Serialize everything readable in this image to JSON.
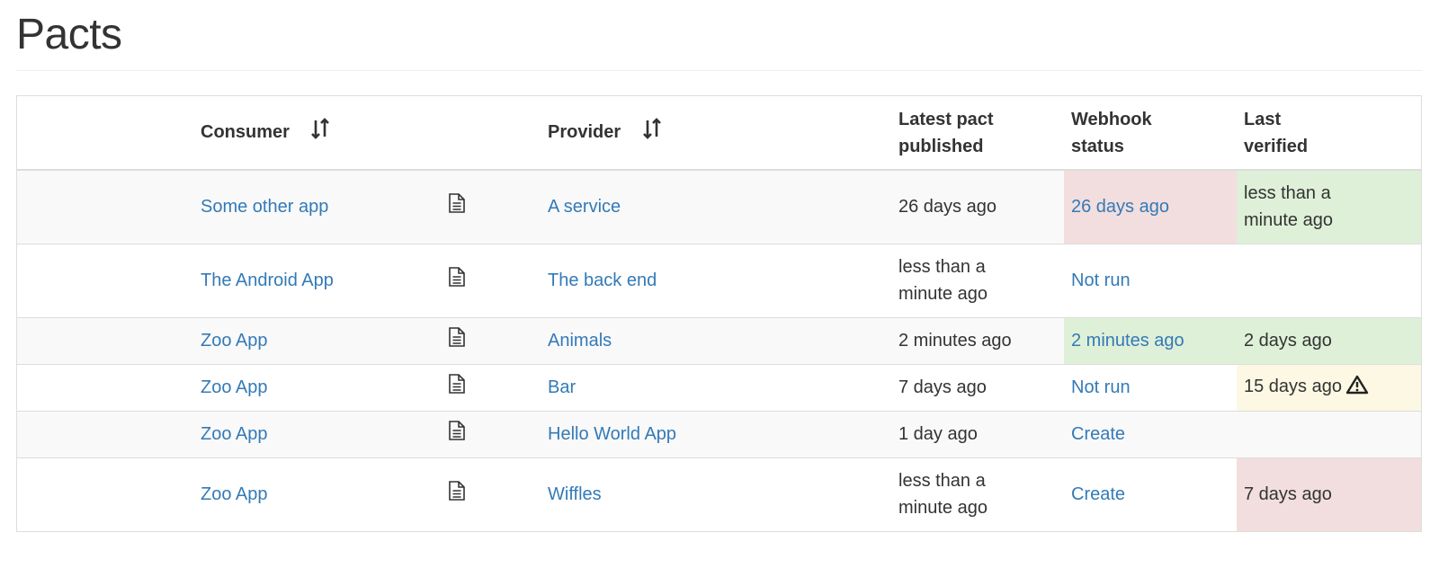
{
  "page": {
    "title": "Pacts"
  },
  "table": {
    "headers": {
      "consumer": "Consumer",
      "provider": "Provider",
      "published_line1": "Latest pact",
      "published_line2": "published",
      "webhook_line1": "Webhook",
      "webhook_line2": "status",
      "verified_line1": "Last",
      "verified_line2": "verified"
    },
    "rows": [
      {
        "consumer": "Some other app",
        "provider": "A service",
        "published": "26 days ago",
        "webhook": "26 days ago",
        "webhook_state": "danger",
        "verified_line1": "less than a",
        "verified_line2": "minute ago",
        "verified_state": "success"
      },
      {
        "consumer": "The Android App",
        "provider": "The back end",
        "published_line1": "less than a",
        "published_line2": "minute ago",
        "webhook": "Not run",
        "webhook_state": "none",
        "verified": "",
        "verified_state": "none"
      },
      {
        "consumer": "Zoo App",
        "provider": "Animals",
        "published": "2 minutes ago",
        "webhook": "2 minutes ago",
        "webhook_state": "success",
        "verified": "2 days ago",
        "verified_state": "success"
      },
      {
        "consumer": "Zoo App",
        "provider": "Bar",
        "published": "7 days ago",
        "webhook": "Not run",
        "webhook_state": "none",
        "verified": "15 days ago",
        "verified_state": "warning",
        "verified_icon": "warning-triangle-icon"
      },
      {
        "consumer": "Zoo App",
        "provider": "Hello World App",
        "published": "1 day ago",
        "webhook": "Create",
        "webhook_state": "none",
        "verified": "",
        "verified_state": "none"
      },
      {
        "consumer": "Zoo App",
        "provider": "Wiffles",
        "published_line1": "less than a",
        "published_line2": "minute ago",
        "webhook": "Create",
        "webhook_state": "none",
        "verified": "7 days ago",
        "verified_state": "danger"
      }
    ]
  },
  "icons": {
    "sort": "sort-arrows-icon",
    "document": "document-icon",
    "warning": "warning-triangle-icon"
  },
  "colors": {
    "link": "#337ab7",
    "danger_bg": "#f2dede",
    "success_bg": "#dff0d8",
    "warning_bg": "#fcf8e3",
    "stripe_bg": "#f9f9f9"
  }
}
